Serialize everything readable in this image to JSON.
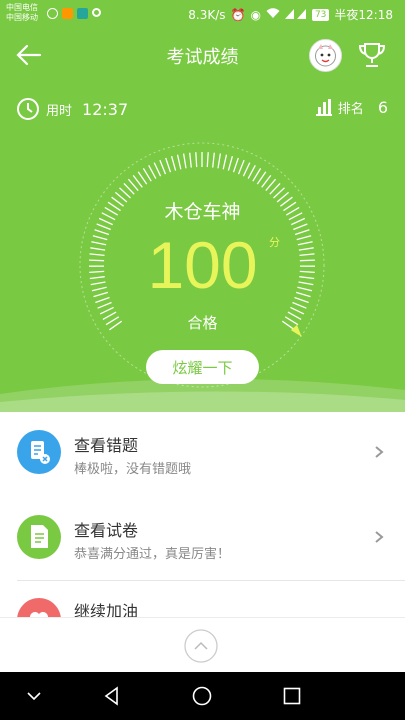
{
  "status_bar": {
    "carrier_1": "中国电信",
    "carrier_2": "中国移动",
    "speed": "8.3K/s",
    "battery": "73",
    "time": "半夜12:18"
  },
  "header": {
    "title": "考试成绩"
  },
  "stats": {
    "time_label": "用时",
    "time_value": "12:37",
    "rank_label": "排名",
    "rank_value": "6"
  },
  "result": {
    "username": "木仓车神",
    "score": "100",
    "score_unit": "分",
    "grade": "合格",
    "share_label": "炫耀一下"
  },
  "menu": [
    {
      "title": "查看错题",
      "subtitle": "棒极啦，没有错题哦",
      "icon": "wrong-questions-icon",
      "color": "#3aa4ea"
    },
    {
      "title": "查看试卷",
      "subtitle": "恭喜满分通过，真是厉害！",
      "icon": "exam-paper-icon",
      "color": "#7ac943"
    },
    {
      "title": "继续加油",
      "icon": "heart-icon",
      "color": "#f06a6a"
    }
  ],
  "colors": {
    "primary": "#7ac943",
    "score": "#e8f55a",
    "status_icon_1": "#ff9800",
    "status_icon_2": "#26a69a"
  }
}
